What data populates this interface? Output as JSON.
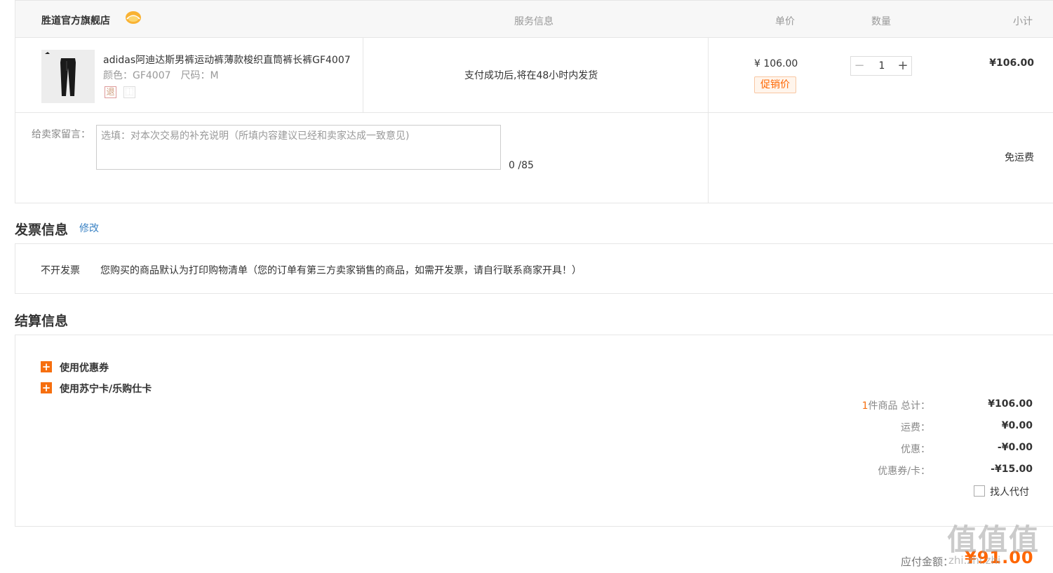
{
  "order": {
    "store_name": "胜道官方旗舰店",
    "columns": {
      "service": "服务信息",
      "unit_price": "单价",
      "quantity": "数量",
      "subtotal": "小计"
    },
    "item": {
      "title": "adidas阿迪达斯男裤运动裤薄款梭织直筒裤长裤GF4007",
      "color_label": "颜色：GF4007",
      "size_label": "尺码：M",
      "service_icon_return": "退",
      "service_icon_other": "⿰",
      "shipping_note": "支付成功后,将在48小时内发货",
      "unit_price": "¥ 106.00",
      "promo_tag": "促销价",
      "quantity": "1",
      "subtotal": "¥106.00"
    },
    "message": {
      "label": "给卖家留言：",
      "placeholder": "选填：对本次交易的补充说明（所填内容建议已经和卖家达成一致意见)",
      "value": "",
      "count": "0 /85"
    },
    "shipping_fee_text": "免运费"
  },
  "invoice": {
    "title": "发票信息",
    "modify_link": "修改",
    "type": "不开发票",
    "description": "您购买的商品默认为打印购物清单（您的订单有第三方卖家销售的商品，如需开发票，请自行联系商家开具！）"
  },
  "settlement": {
    "title": "结算信息",
    "use_coupon": "使用优惠券",
    "use_card": "使用苏宁卡/乐购仕卡",
    "summary": {
      "item_count": "1",
      "item_count_suffix": "件商品 总计：",
      "total": "¥106.00",
      "shipping_label": "运费：",
      "shipping": "¥0.00",
      "discount_label": "优惠：",
      "discount": "-¥0.00",
      "coupon_label": "优惠券/卡：",
      "coupon": "-¥15.00",
      "proxy_pay_label": "找人代付"
    },
    "payable_label": "应付金额：",
    "payable_amount": "¥91.00"
  },
  "watermark": {
    "text": "值值值",
    "sub": "zhi.zhi.zhi"
  },
  "icons": {
    "store_badge": "store-badge-icon",
    "minus": "minus-icon",
    "plus": "plus-icon",
    "expand": "plus-square-icon"
  },
  "colors": {
    "accent": "#f66f0f",
    "link": "#3a82c4",
    "border": "#e6e6e6",
    "header_bg": "#f7f7f7"
  }
}
